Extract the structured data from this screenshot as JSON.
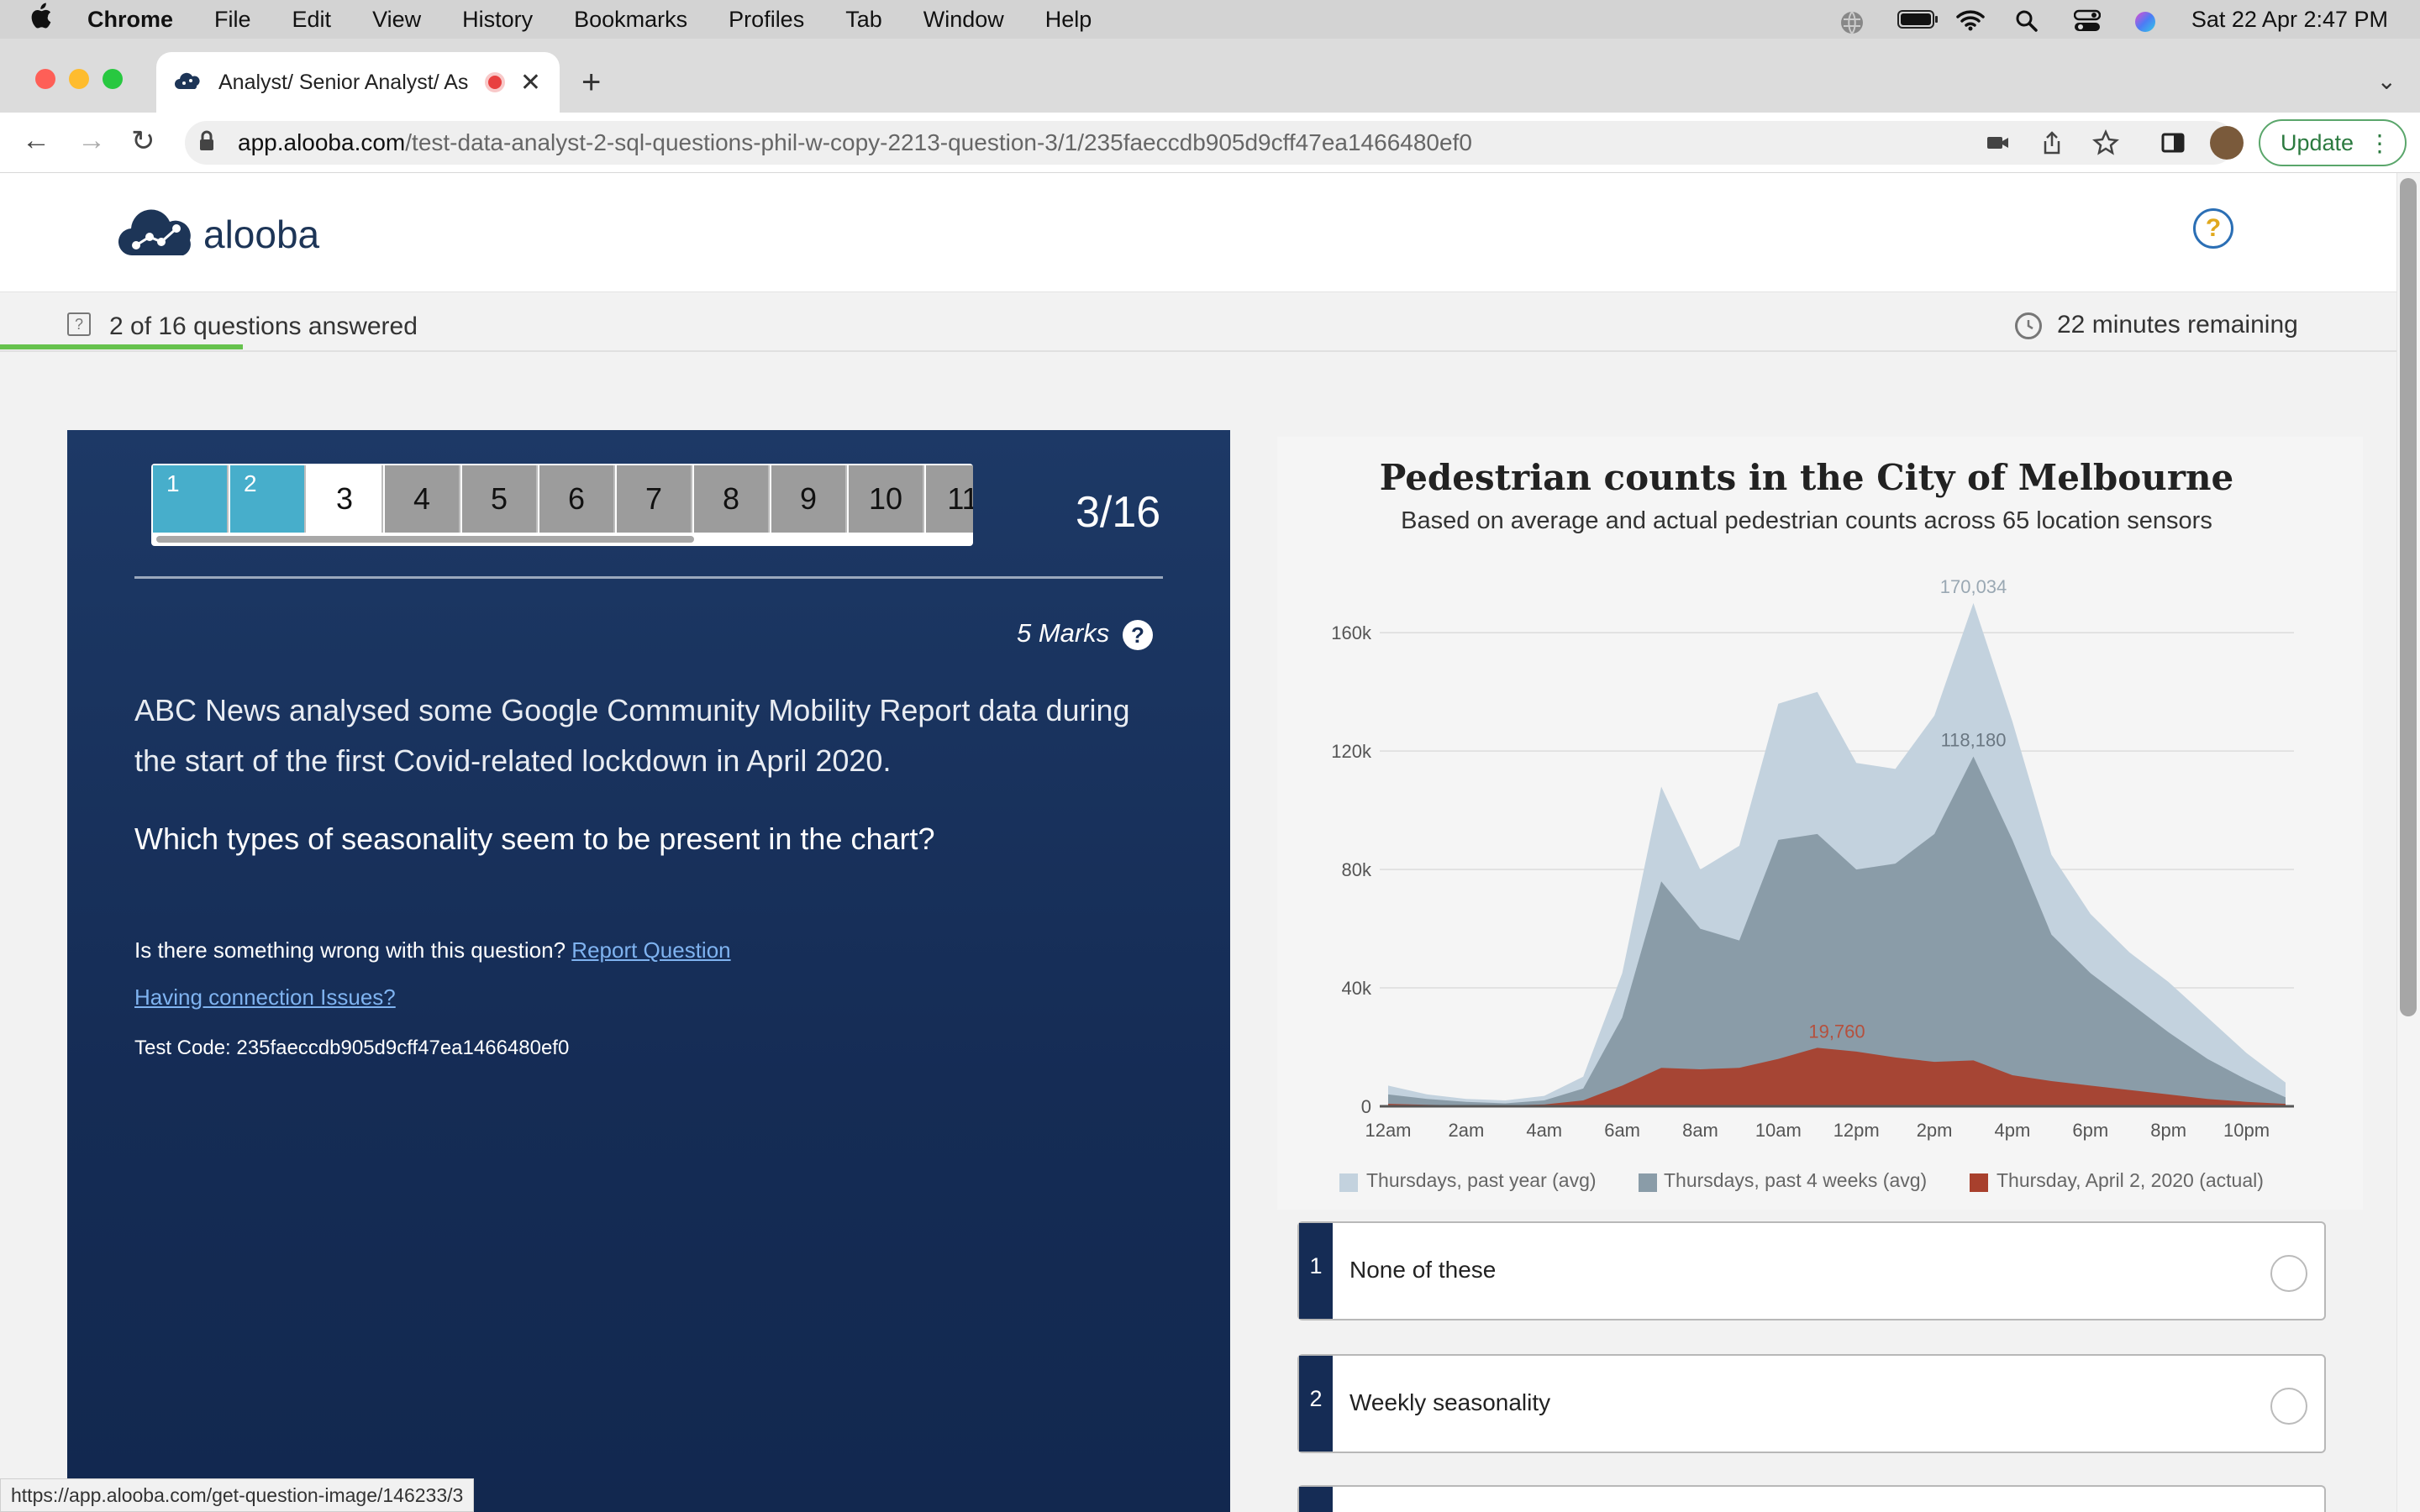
{
  "menubar": {
    "app": "Chrome",
    "items": [
      "File",
      "Edit",
      "View",
      "History",
      "Bookmarks",
      "Profiles",
      "Tab",
      "Window",
      "Help"
    ],
    "clock": "Sat 22 Apr  2:47 PM"
  },
  "browser": {
    "tab_title": "Analyst/ Senior Analyst/ As",
    "url_host": "app.alooba.com",
    "url_path": "/test-data-analyst-2-sql-questions-phil-w-copy-2213-question-3/1/235faeccdb905d9cff47ea1466480ef0",
    "update_label": "Update",
    "status_url": "https://app.alooba.com/get-question-image/146233/3"
  },
  "header": {
    "brand": "alooba",
    "help_symbol": "?"
  },
  "progress": {
    "answered_text": "2 of 16 questions answered",
    "remaining_text": "22 minutes remaining",
    "fraction": 0.125
  },
  "question_nav": {
    "items": [
      {
        "label": "1",
        "state": "answered"
      },
      {
        "label": "2",
        "state": "answered"
      },
      {
        "label": "3",
        "state": "current"
      },
      {
        "label": "4",
        "state": "unanswered"
      },
      {
        "label": "5",
        "state": "unanswered"
      },
      {
        "label": "6",
        "state": "unanswered"
      },
      {
        "label": "7",
        "state": "unanswered"
      },
      {
        "label": "8",
        "state": "unanswered"
      },
      {
        "label": "9",
        "state": "unanswered"
      },
      {
        "label": "10",
        "state": "unanswered"
      },
      {
        "label": "11",
        "state": "unanswered"
      }
    ],
    "counter": "3/16"
  },
  "question": {
    "marks": "5 Marks",
    "intro": "ABC News analysed some Google Community Mobility Report data during the start of the first Covid-related lockdown in April 2020.",
    "text": "Which types of seasonality seem to be present in the chart?",
    "report_prompt": "Is there something wrong with this question?",
    "report_link": "Report Question",
    "connection_link": "Having connection Issues?",
    "test_code": "Test Code: 235faeccdb905d9cff47ea1466480ef0"
  },
  "options": [
    {
      "num": "1",
      "label": "None of these"
    },
    {
      "num": "2",
      "label": "Weekly seasonality"
    }
  ],
  "colors": {
    "navy": "#152c55",
    "answered": "#47aecb",
    "progress": "#66c24d",
    "series_past_year": "#c3d2de",
    "series_past_4_weeks": "#8a9ca8",
    "series_actual": "#a8402d"
  },
  "chart_data": {
    "type": "area",
    "title": "Pedestrian counts in the City of Melbourne",
    "subtitle": "Based on average and actual pedestrian counts across 65 location sensors",
    "x_tick_labels": [
      "12am",
      "2am",
      "4am",
      "6am",
      "8am",
      "10am",
      "12pm",
      "2pm",
      "4pm",
      "6pm",
      "8pm",
      "10pm"
    ],
    "y_tick_labels": [
      "0",
      "40k",
      "80k",
      "120k",
      "160k"
    ],
    "ylim": [
      0,
      170000
    ],
    "xlim": [
      0,
      23
    ],
    "x": [
      0,
      1,
      2,
      3,
      4,
      5,
      6,
      7,
      8,
      9,
      10,
      11,
      12,
      13,
      14,
      15,
      16,
      17,
      18,
      19,
      20,
      21,
      22,
      23
    ],
    "series": [
      {
        "name": "Thursdays, past year (avg)",
        "values": [
          7000,
          4000,
          2500,
          2000,
          3500,
          10000,
          45000,
          108000,
          80000,
          88000,
          136000,
          140000,
          116000,
          114000,
          132000,
          170034,
          130000,
          85000,
          65000,
          52000,
          42000,
          30000,
          18000,
          8000
        ]
      },
      {
        "name": "Thursdays, past 4 weeks (avg)",
        "values": [
          4000,
          2500,
          1500,
          1000,
          2000,
          6000,
          30000,
          76000,
          60000,
          56000,
          90000,
          92000,
          80000,
          82000,
          92000,
          118180,
          90000,
          58000,
          45000,
          35000,
          25000,
          16000,
          9000,
          3000
        ]
      },
      {
        "name": "Thursday, April 2, 2020 (actual)",
        "values": [
          800,
          500,
          300,
          300,
          600,
          2000,
          7000,
          13000,
          12500,
          13000,
          16000,
          19760,
          18500,
          16500,
          15000,
          15500,
          10500,
          8500,
          7000,
          5500,
          4000,
          2500,
          1500,
          800
        ]
      }
    ],
    "annotations": [
      {
        "text": "170,034",
        "x": 15,
        "y": 170034
      },
      {
        "text": "118,180",
        "x": 15,
        "y": 118180
      },
      {
        "text": "19,760",
        "x": 11.5,
        "y": 19760
      }
    ],
    "grid": true,
    "legend_position": "bottom"
  }
}
